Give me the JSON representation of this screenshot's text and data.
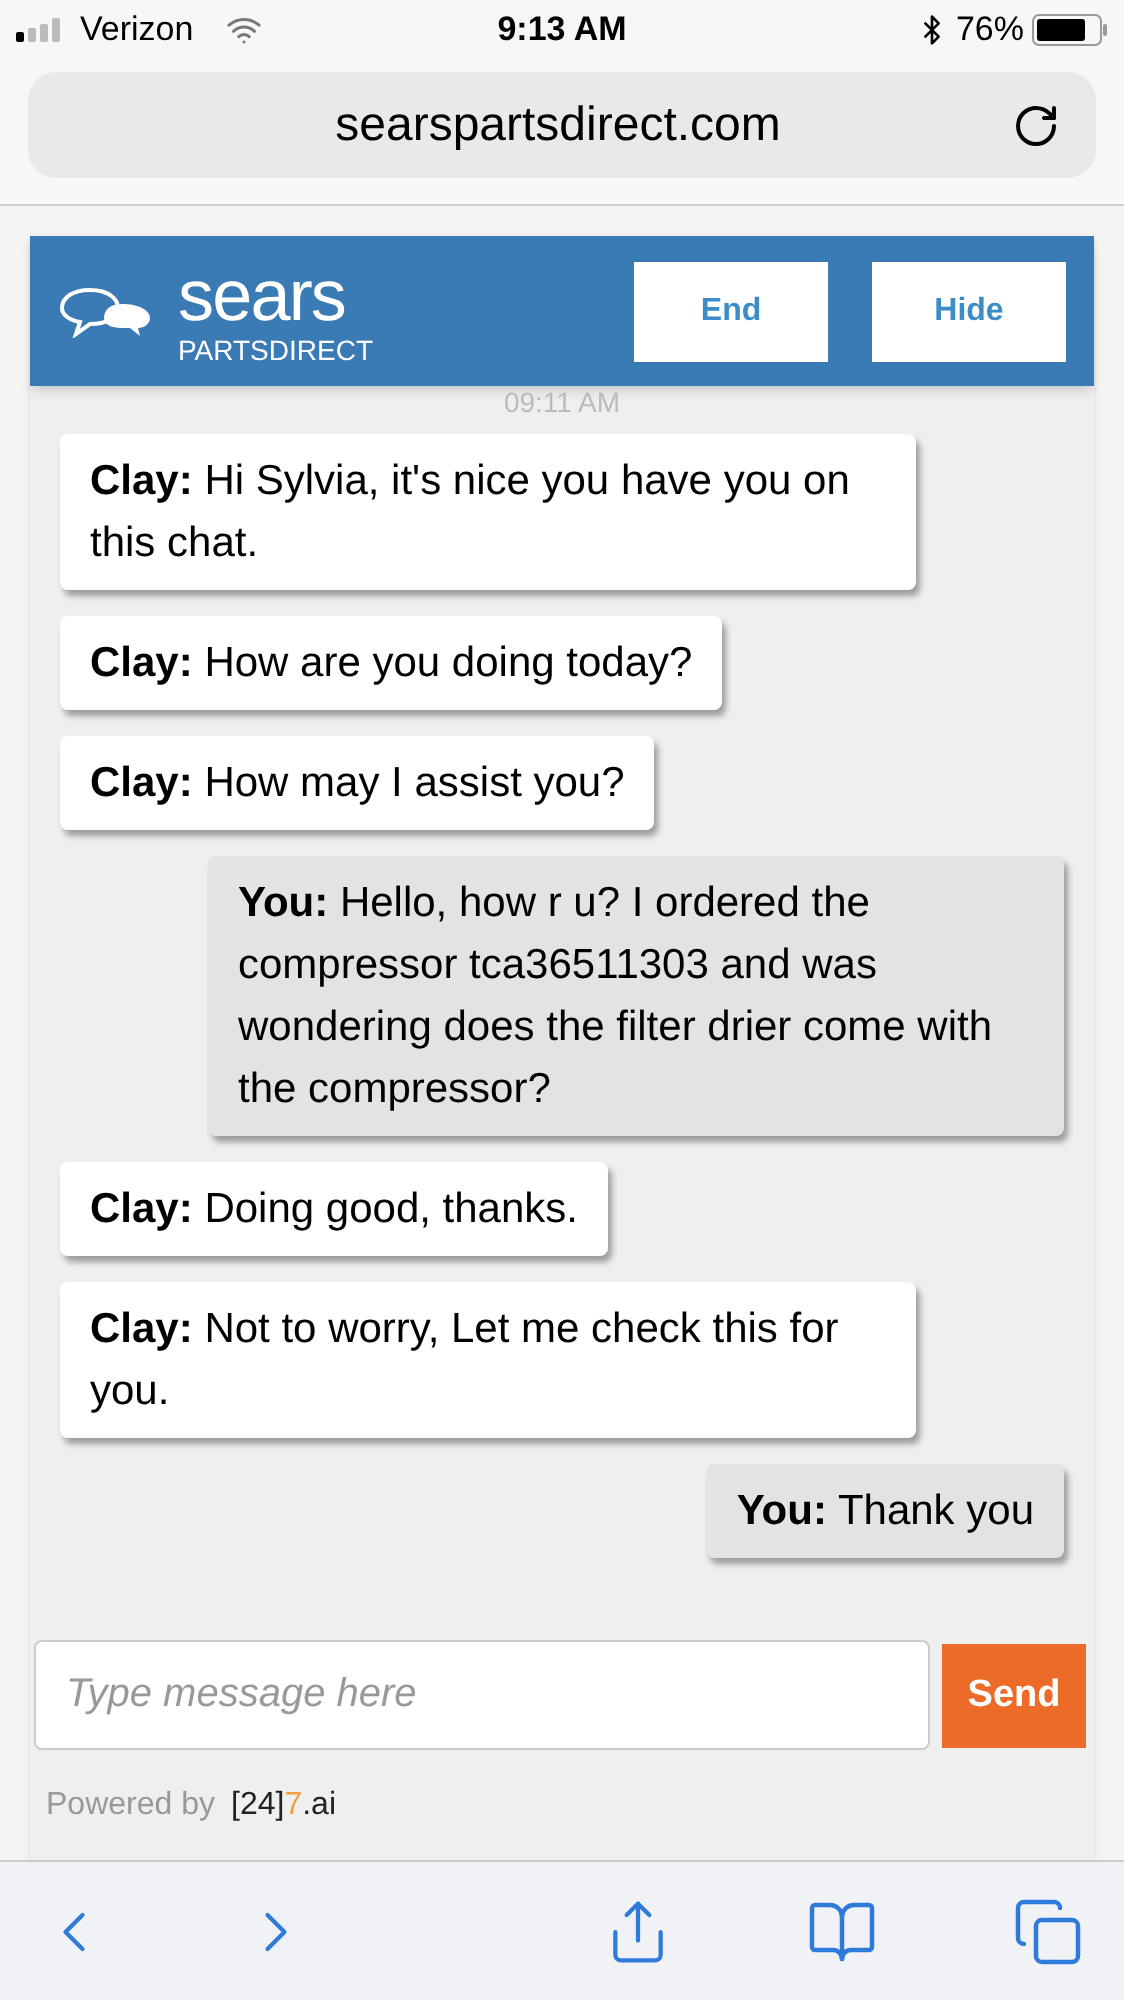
{
  "status_bar": {
    "carrier": "Verizon",
    "time": "9:13 AM",
    "battery": "76%"
  },
  "address_bar": {
    "url": "searspartsdirect.com"
  },
  "chat": {
    "brand": "sears",
    "brand_sub": "PARTSDIRECT",
    "buttons": [
      "End",
      "Hide"
    ],
    "timestamp": "09:11 AM",
    "messages": [
      {
        "kind": "agent",
        "sender": "Clay:",
        "text": "Hi Sylvia, it's nice you have you on this chat."
      },
      {
        "kind": "agent",
        "sender": "Clay:",
        "text": "How are you doing today?"
      },
      {
        "kind": "agent",
        "sender": "Clay:",
        "text": "How may I assist you?"
      },
      {
        "kind": "user",
        "sender": "You:",
        "text": "Hello, how r u? I ordered the compressor tca36511303 and was wondering does the filter drier come with the compressor?"
      },
      {
        "kind": "agent",
        "sender": "Clay:",
        "text": "Doing good, thanks."
      },
      {
        "kind": "agent",
        "sender": "Clay:",
        "text": "Not to worry, Let me check this for you."
      },
      {
        "kind": "user",
        "sender": "You:",
        "text": "Thank you"
      }
    ],
    "input": {
      "placeholder": "Type message here"
    },
    "send": "Send",
    "powered_by": "Powered by",
    "vendor": {
      "prefix": "[24]",
      "accent": "7",
      "suffix": ".ai"
    }
  }
}
